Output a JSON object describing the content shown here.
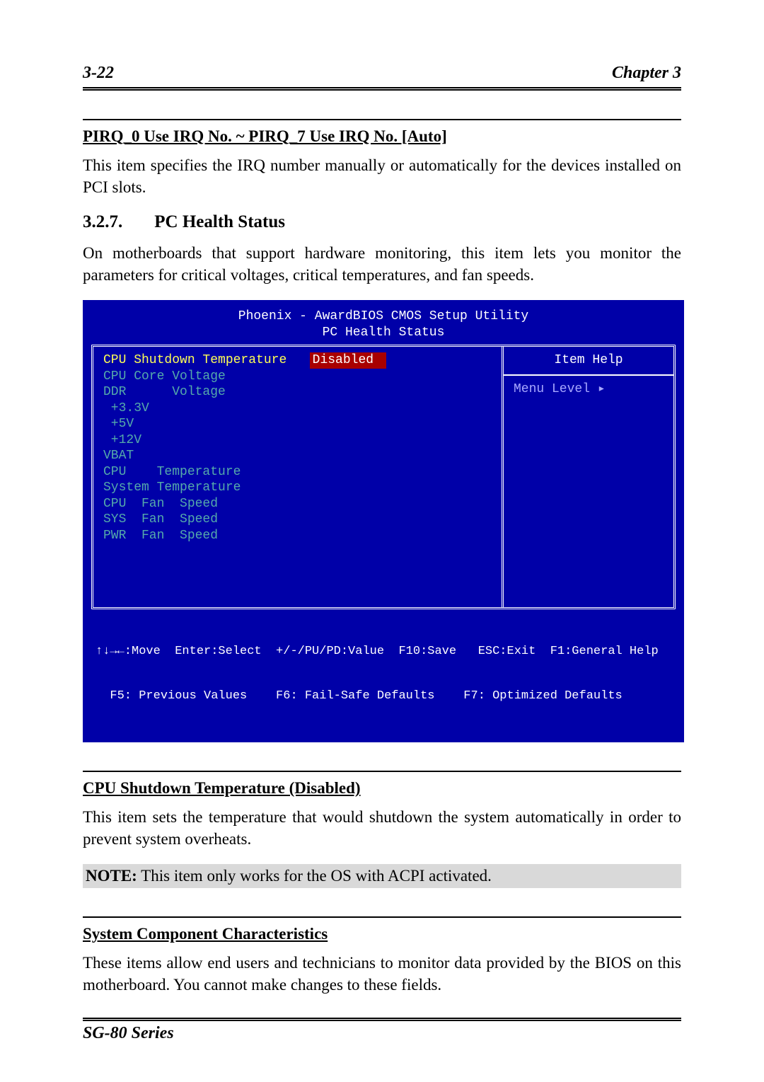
{
  "header": {
    "page_num": "3-22",
    "chapter": "Chapter 3"
  },
  "sec1": {
    "title": "PIRQ_0 Use IRQ No. ~ PIRQ_7 Use IRQ No. [Auto]",
    "body": "This item specifies the IRQ number manually or automatically for the devices installed on PCI slots."
  },
  "sec2": {
    "num": "3.2.7.",
    "title": "PC Health Status",
    "body": "On motherboards that support hardware monitoring, this item lets you monitor the parameters for critical voltages, critical temperatures, and fan speeds."
  },
  "bios": {
    "title_line1": "Phoenix - AwardBIOS CMOS Setup Utility",
    "title_line2": "PC Health Status",
    "item_help": "Item Help",
    "menu_level": "Menu Level   ▸",
    "rows": {
      "r1_label": "CPU Shutdown Temperature   ",
      "r1_value": "Disabled",
      "ro1": "CPU Core Voltage",
      "ro2": "DDR      Voltage",
      "ro3": " +3.3V",
      "ro4": " +5V",
      "ro5": " +12V",
      "ro6": "VBAT",
      "ro7": "CPU    Temperature",
      "ro8": "System Temperature",
      "ro9": "CPU  Fan  Speed",
      "ro10": "SYS  Fan  Speed",
      "ro11": "PWR  Fan  Speed"
    },
    "footer_line1": "↑↓→←:Move  Enter:Select  +/-/PU/PD:Value  F10:Save   ESC:Exit  F1:General Help",
    "footer_line2": "  F5: Previous Values    F6: Fail-Safe Defaults    F7: Optimized Defaults"
  },
  "sec3": {
    "title": "CPU Shutdown Temperature (Disabled)",
    "body": "This item sets the temperature that would shutdown the system automatically in order to prevent system overheats.",
    "note_label": "NOTE:",
    "note_body": " This item only works for the OS with ACPI activated."
  },
  "sec4": {
    "title": "System Component Characteristics",
    "body": "These items allow end users and technicians to monitor data provided by the BIOS on this motherboard. You cannot make changes to these fields."
  },
  "footer": {
    "series": "SG-80 Series"
  }
}
